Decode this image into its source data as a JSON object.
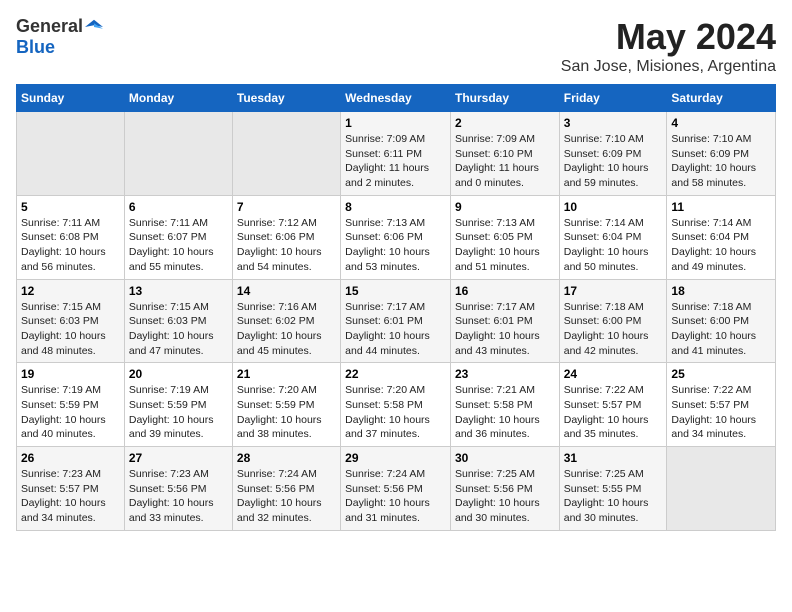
{
  "logo": {
    "general": "General",
    "blue": "Blue"
  },
  "title": "May 2024",
  "subtitle": "San Jose, Misiones, Argentina",
  "days_header": [
    "Sunday",
    "Monday",
    "Tuesday",
    "Wednesday",
    "Thursday",
    "Friday",
    "Saturday"
  ],
  "weeks": [
    [
      {
        "day": "",
        "info": ""
      },
      {
        "day": "",
        "info": ""
      },
      {
        "day": "",
        "info": ""
      },
      {
        "day": "1",
        "info": "Sunrise: 7:09 AM\nSunset: 6:11 PM\nDaylight: 11 hours\nand 2 minutes."
      },
      {
        "day": "2",
        "info": "Sunrise: 7:09 AM\nSunset: 6:10 PM\nDaylight: 11 hours\nand 0 minutes."
      },
      {
        "day": "3",
        "info": "Sunrise: 7:10 AM\nSunset: 6:09 PM\nDaylight: 10 hours\nand 59 minutes."
      },
      {
        "day": "4",
        "info": "Sunrise: 7:10 AM\nSunset: 6:09 PM\nDaylight: 10 hours\nand 58 minutes."
      }
    ],
    [
      {
        "day": "5",
        "info": "Sunrise: 7:11 AM\nSunset: 6:08 PM\nDaylight: 10 hours\nand 56 minutes."
      },
      {
        "day": "6",
        "info": "Sunrise: 7:11 AM\nSunset: 6:07 PM\nDaylight: 10 hours\nand 55 minutes."
      },
      {
        "day": "7",
        "info": "Sunrise: 7:12 AM\nSunset: 6:06 PM\nDaylight: 10 hours\nand 54 minutes."
      },
      {
        "day": "8",
        "info": "Sunrise: 7:13 AM\nSunset: 6:06 PM\nDaylight: 10 hours\nand 53 minutes."
      },
      {
        "day": "9",
        "info": "Sunrise: 7:13 AM\nSunset: 6:05 PM\nDaylight: 10 hours\nand 51 minutes."
      },
      {
        "day": "10",
        "info": "Sunrise: 7:14 AM\nSunset: 6:04 PM\nDaylight: 10 hours\nand 50 minutes."
      },
      {
        "day": "11",
        "info": "Sunrise: 7:14 AM\nSunset: 6:04 PM\nDaylight: 10 hours\nand 49 minutes."
      }
    ],
    [
      {
        "day": "12",
        "info": "Sunrise: 7:15 AM\nSunset: 6:03 PM\nDaylight: 10 hours\nand 48 minutes."
      },
      {
        "day": "13",
        "info": "Sunrise: 7:15 AM\nSunset: 6:03 PM\nDaylight: 10 hours\nand 47 minutes."
      },
      {
        "day": "14",
        "info": "Sunrise: 7:16 AM\nSunset: 6:02 PM\nDaylight: 10 hours\nand 45 minutes."
      },
      {
        "day": "15",
        "info": "Sunrise: 7:17 AM\nSunset: 6:01 PM\nDaylight: 10 hours\nand 44 minutes."
      },
      {
        "day": "16",
        "info": "Sunrise: 7:17 AM\nSunset: 6:01 PM\nDaylight: 10 hours\nand 43 minutes."
      },
      {
        "day": "17",
        "info": "Sunrise: 7:18 AM\nSunset: 6:00 PM\nDaylight: 10 hours\nand 42 minutes."
      },
      {
        "day": "18",
        "info": "Sunrise: 7:18 AM\nSunset: 6:00 PM\nDaylight: 10 hours\nand 41 minutes."
      }
    ],
    [
      {
        "day": "19",
        "info": "Sunrise: 7:19 AM\nSunset: 5:59 PM\nDaylight: 10 hours\nand 40 minutes."
      },
      {
        "day": "20",
        "info": "Sunrise: 7:19 AM\nSunset: 5:59 PM\nDaylight: 10 hours\nand 39 minutes."
      },
      {
        "day": "21",
        "info": "Sunrise: 7:20 AM\nSunset: 5:59 PM\nDaylight: 10 hours\nand 38 minutes."
      },
      {
        "day": "22",
        "info": "Sunrise: 7:20 AM\nSunset: 5:58 PM\nDaylight: 10 hours\nand 37 minutes."
      },
      {
        "day": "23",
        "info": "Sunrise: 7:21 AM\nSunset: 5:58 PM\nDaylight: 10 hours\nand 36 minutes."
      },
      {
        "day": "24",
        "info": "Sunrise: 7:22 AM\nSunset: 5:57 PM\nDaylight: 10 hours\nand 35 minutes."
      },
      {
        "day": "25",
        "info": "Sunrise: 7:22 AM\nSunset: 5:57 PM\nDaylight: 10 hours\nand 34 minutes."
      }
    ],
    [
      {
        "day": "26",
        "info": "Sunrise: 7:23 AM\nSunset: 5:57 PM\nDaylight: 10 hours\nand 34 minutes."
      },
      {
        "day": "27",
        "info": "Sunrise: 7:23 AM\nSunset: 5:56 PM\nDaylight: 10 hours\nand 33 minutes."
      },
      {
        "day": "28",
        "info": "Sunrise: 7:24 AM\nSunset: 5:56 PM\nDaylight: 10 hours\nand 32 minutes."
      },
      {
        "day": "29",
        "info": "Sunrise: 7:24 AM\nSunset: 5:56 PM\nDaylight: 10 hours\nand 31 minutes."
      },
      {
        "day": "30",
        "info": "Sunrise: 7:25 AM\nSunset: 5:56 PM\nDaylight: 10 hours\nand 30 minutes."
      },
      {
        "day": "31",
        "info": "Sunrise: 7:25 AM\nSunset: 5:55 PM\nDaylight: 10 hours\nand 30 minutes."
      },
      {
        "day": "",
        "info": ""
      }
    ]
  ]
}
